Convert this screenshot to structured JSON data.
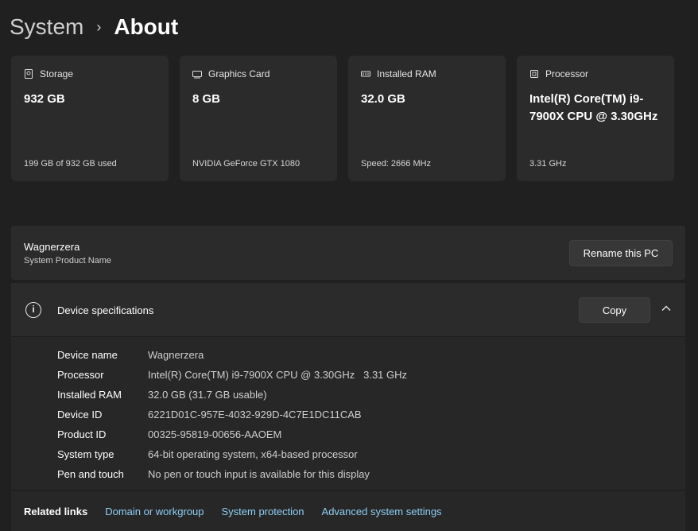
{
  "breadcrumb": {
    "parent": "System",
    "separator": "›",
    "current": "About"
  },
  "cards": [
    {
      "icon": "storage-icon",
      "label": "Storage",
      "value": "932 GB",
      "footer": "199 GB of 932 GB used"
    },
    {
      "icon": "graphics-card-icon",
      "label": "Graphics Card",
      "value": "8 GB",
      "footer": "NVIDIA GeForce GTX 1080"
    },
    {
      "icon": "ram-icon",
      "label": "Installed RAM",
      "value": "32.0 GB",
      "footer": "Speed: 2666 MHz"
    },
    {
      "icon": "processor-icon",
      "label": "Processor",
      "value": "Intel(R) Core(TM) i9-7900X CPU @ 3.30GHz",
      "footer": "3.31 GHz"
    }
  ],
  "pc": {
    "name": "Wagnerzera",
    "subtitle": "System Product Name",
    "rename_label": "Rename this PC"
  },
  "specs": {
    "title": "Device specifications",
    "copy_label": "Copy",
    "rows": [
      {
        "label": "Device name",
        "value": "Wagnerzera"
      },
      {
        "label": "Processor",
        "value": "Intel(R) Core(TM) i9-7900X CPU @ 3.30GHz   3.31 GHz"
      },
      {
        "label": "Installed RAM",
        "value": "32.0 GB (31.7 GB usable)"
      },
      {
        "label": "Device ID",
        "value": "6221D01C-957E-4032-929D-4C7E1DC11CAB"
      },
      {
        "label": "Product ID",
        "value": "00325-95819-00656-AAOEM"
      },
      {
        "label": "System type",
        "value": "64-bit operating system, x64-based processor"
      },
      {
        "label": "Pen and touch",
        "value": "No pen or touch input is available for this display"
      }
    ]
  },
  "related": {
    "title": "Related links",
    "links": [
      "Domain or workgroup",
      "System protection",
      "Advanced system settings"
    ]
  },
  "colors": {
    "background": "#202020",
    "card": "#2b2b2b",
    "link": "#8fd0f5"
  }
}
